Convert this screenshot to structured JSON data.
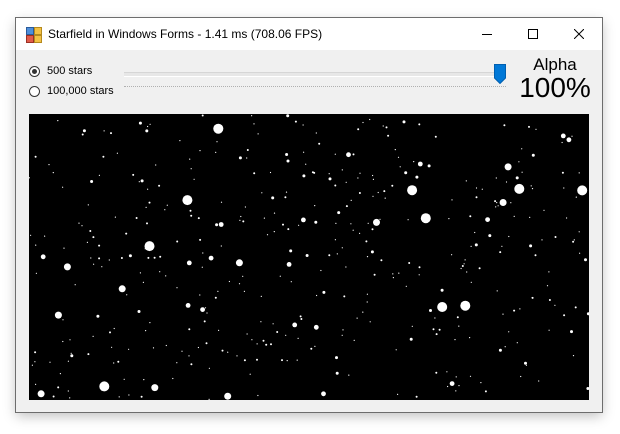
{
  "window": {
    "title": "Starfield in Windows Forms - 1.41 ms (708.06 FPS)",
    "app_icon": "windows-forms-icon",
    "controls": {
      "minimize_icon": "minimize-icon",
      "maximize_icon": "maximize-icon",
      "close_icon": "close-icon"
    }
  },
  "options": {
    "star_count": [
      {
        "label": "500 stars",
        "selected": true
      },
      {
        "label": "100,000 stars",
        "selected": false
      }
    ]
  },
  "alpha": {
    "label": "Alpha",
    "value_text": "100%",
    "value": 1.0
  },
  "colors": {
    "accent": "#0078d7",
    "starfield_background": "#000000",
    "star": "#ffffff",
    "window_background": "#f0f0f0"
  }
}
